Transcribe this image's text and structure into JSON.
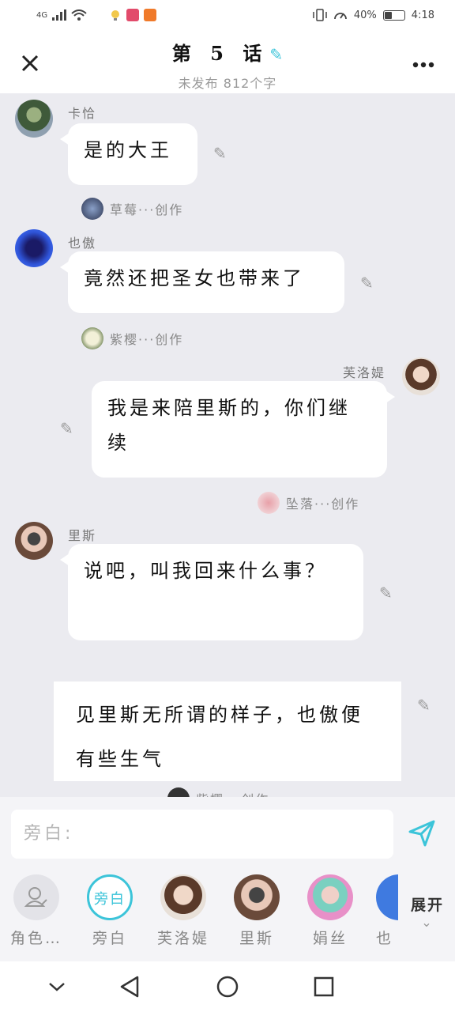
{
  "status": {
    "network": "4G",
    "battery": "40%",
    "time": "4:18"
  },
  "header": {
    "title": "第 5 话",
    "subtitle": "未发布 812个字"
  },
  "messages": [
    {
      "speaker": "卡恰",
      "text": "是的大王",
      "credit_name": "草莓",
      "credit_suffix": "···创作"
    },
    {
      "speaker": "也傲",
      "text": "竟然还把圣女也带来了",
      "credit_name": "紫樱",
      "credit_suffix": "···创作"
    },
    {
      "speaker": "芙洛媞",
      "text": "我是来陪里斯的，你们继续",
      "credit_name": "坠落",
      "credit_suffix": "···创作"
    },
    {
      "speaker": "里斯",
      "text": "说吧，叫我回来什么事？"
    }
  ],
  "narration": {
    "text": "见里斯无所谓的样子，也傲便有些生气",
    "credit_partial": "紫樱···创作"
  },
  "input": {
    "placeholder": "旁白:"
  },
  "picker": {
    "items": [
      {
        "label": "角色…"
      },
      {
        "label": "旁白",
        "badge": "旁白"
      },
      {
        "label": "芙洛媞"
      },
      {
        "label": "里斯"
      },
      {
        "label": "娟丝"
      },
      {
        "label": "也"
      }
    ],
    "expand": "展开"
  },
  "colors": {
    "accent": "#3cc4d9",
    "background": "#ebebf0"
  }
}
